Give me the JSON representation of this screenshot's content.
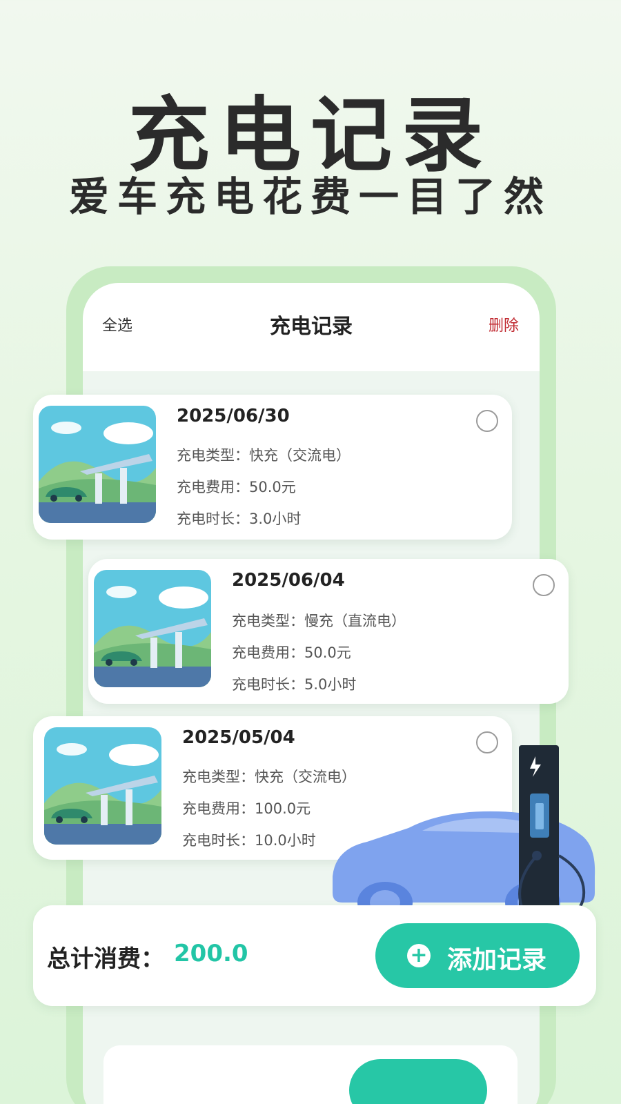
{
  "hero": {
    "title": "充电记录",
    "subtitle": "爱车充电花费一目了然"
  },
  "header": {
    "select_all": "全选",
    "title": "充电记录",
    "delete": "删除"
  },
  "records": [
    {
      "date": "2025/06/30",
      "type_label": "充电类型：",
      "type_value": "快充（交流电）",
      "cost_label": "充电费用：",
      "cost_value": "50.0元",
      "duration_label": "充电时长：",
      "duration_value": "3.0小时"
    },
    {
      "date": "2025/06/04",
      "type_label": "充电类型：",
      "type_value": "慢充（直流电）",
      "cost_label": "充电费用：",
      "cost_value": "50.0元",
      "duration_label": "充电时长：",
      "duration_value": "5.0小时"
    },
    {
      "date": "2025/05/04",
      "type_label": "充电类型：",
      "type_value": "快充（交流电）",
      "cost_label": "充电费用：",
      "cost_value": "100.0元",
      "duration_label": "充电时长：",
      "duration_value": "10.0小时"
    }
  ],
  "summary": {
    "label": "总计消费：",
    "value": "200.0",
    "add_button": "添加记录"
  },
  "colors": {
    "accent": "#27c7a6",
    "delete": "#c0282f",
    "car": "#7fa3ee"
  },
  "icons": {
    "checkbox": "radio-circle-icon",
    "add": "plus-circle-icon",
    "bolt": "lightning-icon"
  }
}
